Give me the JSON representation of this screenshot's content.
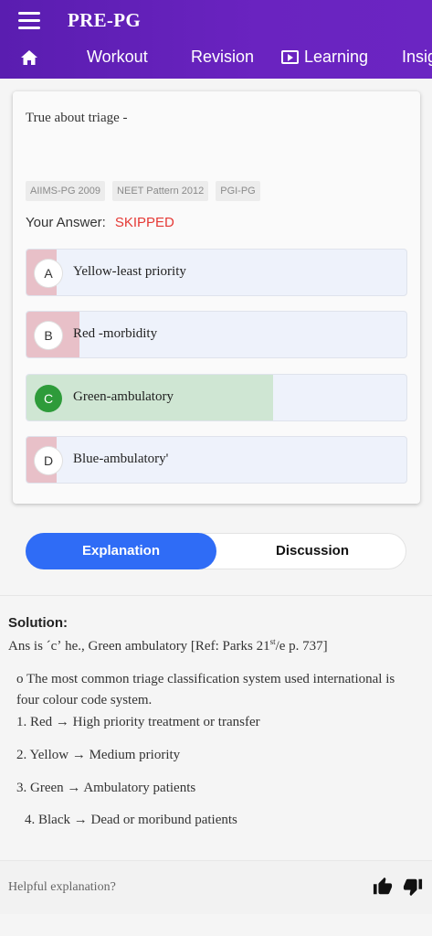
{
  "app": {
    "title": "PRE-PG"
  },
  "tabs": {
    "workout": "Workout",
    "revision": "Revision",
    "learning": "Learning",
    "insights": "Insig"
  },
  "question": {
    "text": "True about triage -",
    "tags": [
      "AIIMS-PG 2009",
      "NEET Pattern 2012",
      "PGI-PG"
    ],
    "your_answer_label": "Your Answer:",
    "your_answer_status": "SKIPPED",
    "options": [
      {
        "letter": "A",
        "text": "Yellow-least priority",
        "percent": 8,
        "fill_color": "#e8c0c8"
      },
      {
        "letter": "B",
        "text": "Red -morbidity",
        "percent": 14,
        "fill_color": "#e8c0c8"
      },
      {
        "letter": "C",
        "text": "Green-ambulatory",
        "percent": 65,
        "fill_color": "#cfe6d3",
        "correct": true
      },
      {
        "letter": "D",
        "text": "Blue-ambulatory'",
        "percent": 8,
        "fill_color": "#e8c0c8"
      }
    ]
  },
  "toggle": {
    "explanation": "Explanation",
    "discussion": "Discussion"
  },
  "solution": {
    "title": "Solution:",
    "answer_pre": "Ans is ˊcʼ he., Green ambulatory [Ref: Parks 21",
    "answer_sup": "st",
    "answer_post": "/e p. 737]",
    "intro": "o The most common triage classification system used international is four colour code system.",
    "items": [
      "1. Red → High priority treatment or transfer",
      "2. Yellow → Medium priority",
      "3. Green → Ambulatory patients",
      "4. Black → Dead or moribund patients"
    ]
  },
  "footer": {
    "helpful": "Helpful explanation?"
  },
  "colors": {
    "header": "#6a23c0",
    "accent": "#2f6cf6",
    "skipped": "#e53935",
    "correct": "#2e9b3a"
  }
}
